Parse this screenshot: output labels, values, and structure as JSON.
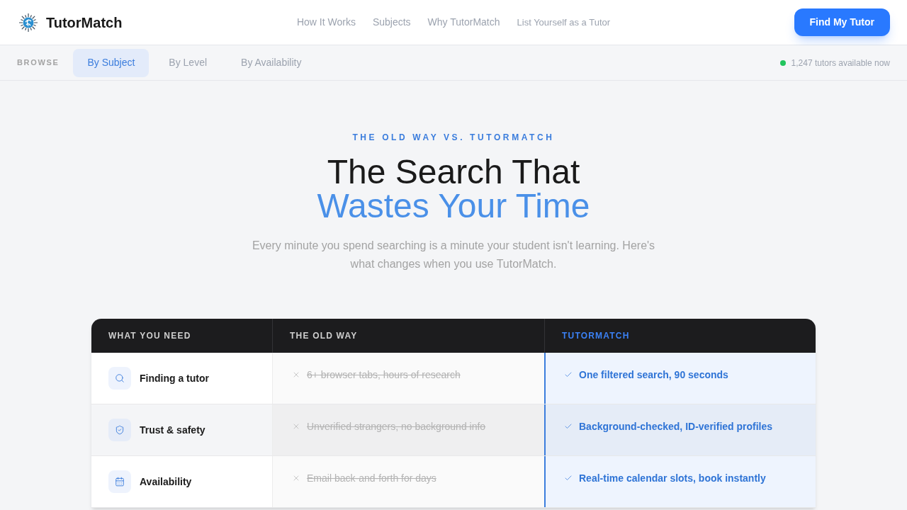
{
  "header": {
    "brand": "TutorMatch",
    "nav": [
      "How It Works",
      "Subjects",
      "Why TutorMatch",
      "List Yourself as a Tutor"
    ],
    "cta": "Find My Tutor"
  },
  "browse_bar": {
    "label": "BROWSE",
    "tabs": [
      {
        "label": "By Subject",
        "selected": true
      },
      {
        "label": "By Level",
        "selected": false
      },
      {
        "label": "By Availability",
        "selected": false
      }
    ],
    "status": {
      "text": "1,247 tutors available now",
      "color": "#22c55e"
    }
  },
  "hero": {
    "eyebrow": "THE OLD WAY VS. TUTORMATCH",
    "title_lines": [
      "The Search That",
      "Wastes Your Time"
    ],
    "intro": "Every minute you spend searching is a minute your student isn't learning. Here's what changes when you use TutorMatch."
  },
  "comparison": {
    "columns": [
      "WHAT YOU NEED",
      "THE OLD WAY",
      "TUTORMATCH"
    ],
    "rows": [
      {
        "kind": "search",
        "need": "Finding a tutor",
        "old_way": "6+ browser tabs, hours of research",
        "tutormatch": "One filtered search, 90 seconds"
      },
      {
        "kind": "shield",
        "need": "Trust & safety",
        "old_way": "Unverified strangers, no background info",
        "tutormatch": "Background-checked, ID-verified profiles"
      },
      {
        "kind": "calendar",
        "need": "Availability",
        "old_way": "Email back-and-forth for days",
        "tutormatch": "Real-time calendar slots, book instantly"
      }
    ]
  }
}
